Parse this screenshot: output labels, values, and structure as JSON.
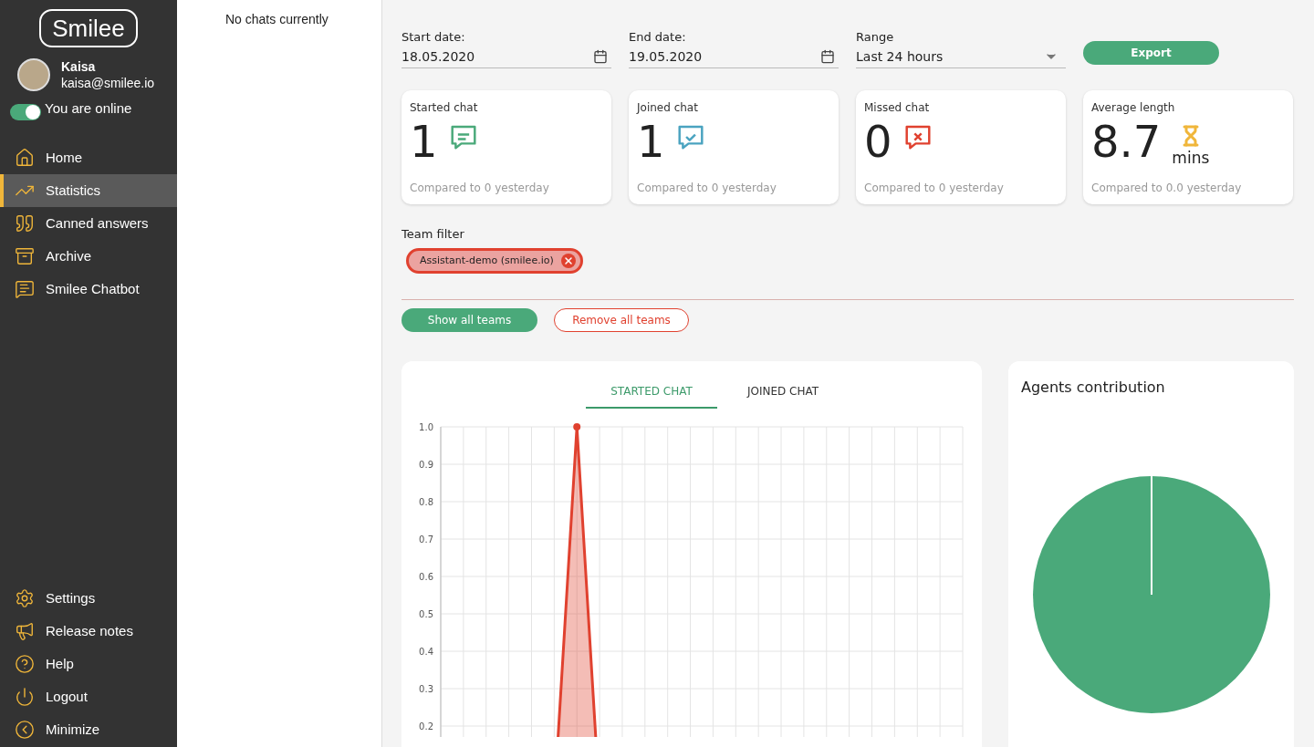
{
  "sidebar": {
    "logo": "Smilee",
    "user": {
      "name": "Kaisa",
      "email": "kaisa@smilee.io"
    },
    "status": {
      "label": "You are online",
      "on": true
    },
    "nav": [
      {
        "kind": "home",
        "label": "Home",
        "selected": false
      },
      {
        "kind": "stats",
        "label": "Statistics",
        "selected": true
      },
      {
        "kind": "quote",
        "label": "Canned answers",
        "selected": false
      },
      {
        "kind": "archive",
        "label": "Archive",
        "selected": false
      },
      {
        "kind": "bot",
        "label": "Smilee Chatbot",
        "selected": false
      }
    ],
    "bottom_nav": [
      {
        "kind": "settings",
        "label": "Settings"
      },
      {
        "kind": "megaphone",
        "label": "Release notes"
      },
      {
        "kind": "help",
        "label": "Help"
      },
      {
        "kind": "power",
        "label": "Logout"
      },
      {
        "kind": "minimize",
        "label": "Minimize"
      }
    ]
  },
  "chats": {
    "empty_text": "No chats currently"
  },
  "filters": {
    "start": {
      "label": "Start date:",
      "value": "18.05.2020"
    },
    "end": {
      "label": "End date:",
      "value": "19.05.2020"
    },
    "range": {
      "label": "Range",
      "value": "Last 24 hours"
    },
    "export": "Export"
  },
  "stats": [
    {
      "kind": "started",
      "title": "Started chat",
      "value": "1",
      "compare": "Compared to 0 yesterday"
    },
    {
      "kind": "joined",
      "title": "Joined chat",
      "value": "1",
      "compare": "Compared to 0 yesterday"
    },
    {
      "kind": "missed",
      "title": "Missed chat",
      "value": "0",
      "compare": "Compared to 0 yesterday"
    },
    {
      "kind": "time",
      "title": "Average length",
      "value": "8.7",
      "unit": "mins",
      "compare": "Compared to 0.0 yesterday"
    }
  ],
  "team_filter": {
    "label": "Team filter",
    "chips": [
      "Assistant-demo (smilee.io)"
    ],
    "show_all": "Show all teams",
    "remove_all": "Remove all teams"
  },
  "chart_card": {
    "tabs": [
      {
        "label": "STARTED CHAT",
        "selected": true
      },
      {
        "label": "JOINED CHAT",
        "selected": false
      }
    ],
    "chart_data": {
      "type": "area",
      "grid": true,
      "ylim": [
        0,
        1
      ],
      "yticks": [
        {
          "value": 0.2,
          "label": "0.2"
        },
        {
          "value": 0.3,
          "label": "0.3"
        },
        {
          "value": 0.4,
          "label": "0.4"
        },
        {
          "value": 0.5,
          "label": "0.5"
        },
        {
          "value": 0.6,
          "label": "0.6"
        },
        {
          "value": 0.7,
          "label": "0.7"
        },
        {
          "value": 0.8,
          "label": "0.8"
        },
        {
          "value": 0.9,
          "label": "0.9"
        },
        {
          "value": 1,
          "label": "1.0"
        }
      ],
      "series": [
        {
          "color": "#e0412f",
          "values": [
            0,
            0,
            0,
            0,
            0,
            0,
            1,
            0,
            0,
            0,
            0,
            0,
            0,
            0,
            0,
            0,
            0,
            0,
            0,
            0,
            0,
            0,
            0,
            0
          ]
        }
      ]
    }
  },
  "agents_card": {
    "title": "Agents contribution"
  }
}
